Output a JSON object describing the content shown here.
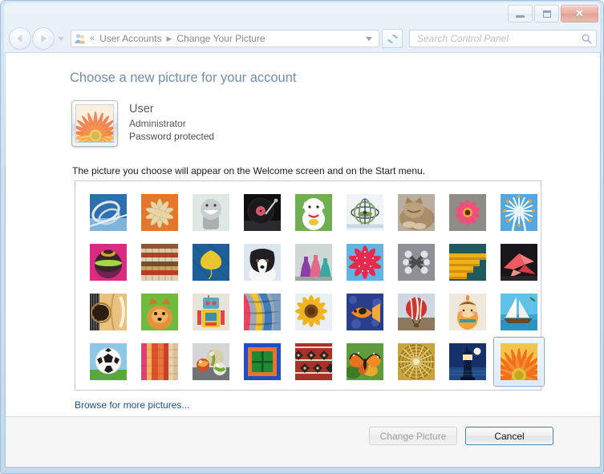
{
  "window": {
    "caption_buttons": {
      "minimize": "Minimize",
      "maximize": "Maximize",
      "close": "Close",
      "close_glyph": "✕"
    }
  },
  "navbar": {
    "back_tooltip": "Back",
    "forward_tooltip": "Forward",
    "recent_pages_tooltip": "Recent Pages",
    "breadcrumb": {
      "overflow_glyph": "«",
      "separator": "▶",
      "items": [
        {
          "label": "User Accounts"
        },
        {
          "label": "Change Your Picture"
        }
      ]
    },
    "address_dropdown_tooltip": "Previous Locations",
    "refresh_tooltip": "Refresh",
    "search": {
      "placeholder": "Search Control Panel",
      "value": ""
    }
  },
  "main": {
    "page_title": "Choose a new picture for your account",
    "user": {
      "name": "User",
      "account_type": "Administrator",
      "password_status": "Password protected"
    },
    "description": "The picture you choose will appear on the Welcome screen and on the Start menu.",
    "browse_link": "Browse for more pictures...",
    "pictures": [
      {
        "name": "rollercoaster"
      },
      {
        "name": "starfish-orange"
      },
      {
        "name": "toy-figure"
      },
      {
        "name": "turntable"
      },
      {
        "name": "lucky-cat"
      },
      {
        "name": "gyroscope"
      },
      {
        "name": "kitten"
      },
      {
        "name": "pink-flower"
      },
      {
        "name": "ferris-wheel"
      },
      {
        "name": "lacquer-spheres"
      },
      {
        "name": "woven-textile"
      },
      {
        "name": "yellow-leaf"
      },
      {
        "name": "border-collie"
      },
      {
        "name": "lava-lamps"
      },
      {
        "name": "red-starfish"
      },
      {
        "name": "chrome-jacks"
      },
      {
        "name": "yellow-stairs"
      },
      {
        "name": "origami-crane"
      },
      {
        "name": "acoustic-guitar"
      },
      {
        "name": "pomeranian"
      },
      {
        "name": "tin-robot"
      },
      {
        "name": "silk-scarves"
      },
      {
        "name": "sunflower"
      },
      {
        "name": "tropical-fish"
      },
      {
        "name": "hot-air-balloon"
      },
      {
        "name": "kokeshi-doll"
      },
      {
        "name": "sailboat"
      },
      {
        "name": "soccer-ball"
      },
      {
        "name": "fabric-stripes"
      },
      {
        "name": "glass-marbles"
      },
      {
        "name": "green-window"
      },
      {
        "name": "patterned-rug"
      },
      {
        "name": "monarch-butterfly"
      },
      {
        "name": "woven-basket"
      },
      {
        "name": "lighthouse-moon"
      },
      {
        "name": "orange-daisy"
      }
    ],
    "selected_picture_index": 35
  },
  "footer": {
    "change_picture_label": "Change Picture",
    "change_picture_enabled": false,
    "cancel_label": "Cancel",
    "cancel_enabled": true
  },
  "colors": {
    "accent_blue": "#1f4b87",
    "link_blue": "#17518f",
    "selection_border": "#7da2ce",
    "close_red": "#d9533f"
  }
}
